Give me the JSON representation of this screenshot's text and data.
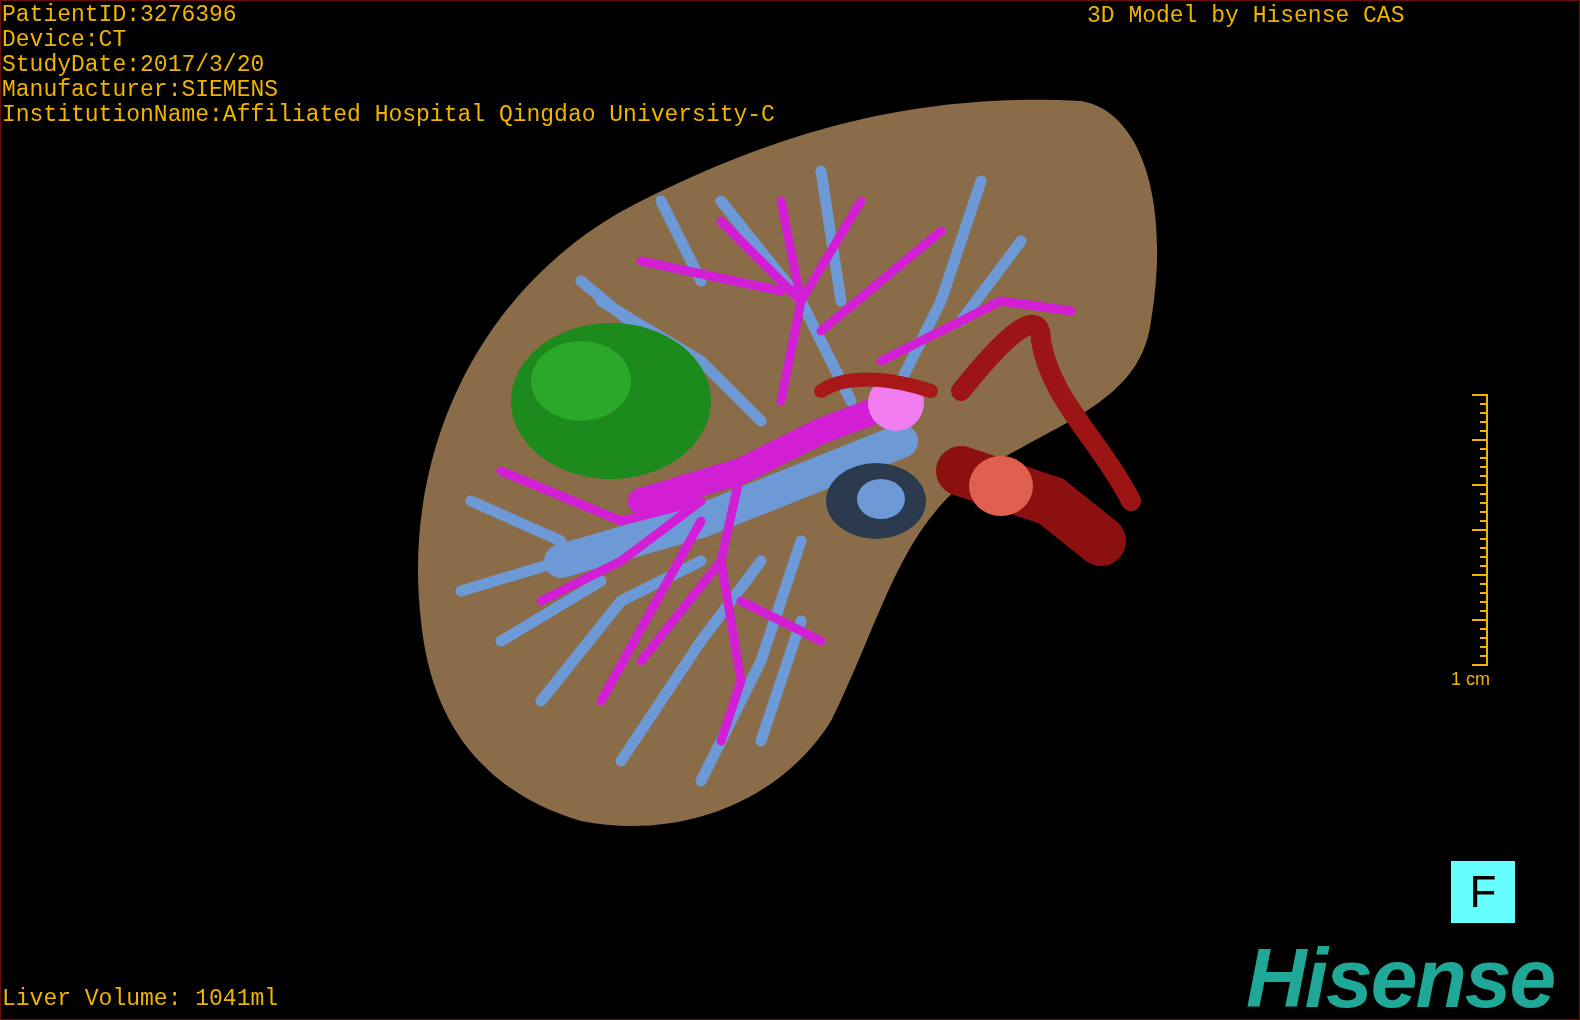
{
  "patient_info": [
    "PatientID:3276396",
    "Device:CT",
    "StudyDate:2017/3/20",
    "Manufacturer:SIEMENS",
    "InstitutionName:Affiliated Hospital Qingdao University-C"
  ],
  "header": "3D Model by Hisense CAS",
  "scale_bar": {
    "label": "1 cm"
  },
  "orientation_button": "F",
  "logo": "Hisense",
  "liver_volume": "Liver Volume: 1041ml"
}
